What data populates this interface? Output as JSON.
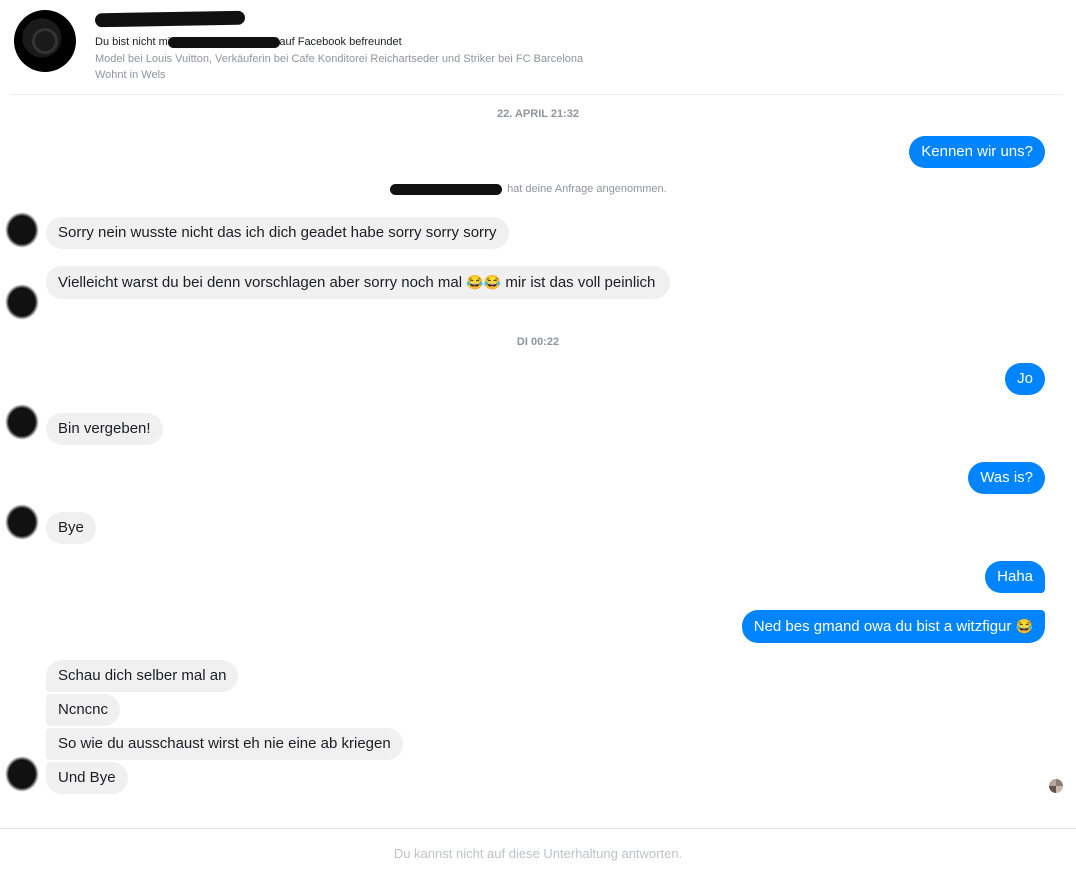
{
  "header": {
    "friend_prefix": "Du bist nicht mit",
    "friend_suffix": "auf Facebook befreundet",
    "work": "Model bei Louis Vuitton, Verkäuferin bei Cafe Konditorei Reichartseder und Striker bei FC Barcelona",
    "lives": "Wohnt in Wels"
  },
  "timestamps": {
    "first": "22. APRIL 21:32",
    "second": "DI 00:22"
  },
  "system_message": "hat deine Anfrage angenommen.",
  "messages": {
    "m1": "Kennen wir uns?",
    "m2": "Sorry nein wusste nicht das ich dich geadet habe sorry sorry sorry",
    "m3_text": "Vielleicht warst du bei denn vorschlagen aber sorry noch mal",
    "m3_emoji": "😂😂",
    "m3_tail": "mir ist das voll peinlich",
    "m4": "Jo",
    "m5": "Bin vergeben!",
    "m6": "Was is?",
    "m7": "Bye",
    "m8": "Haha",
    "m9_text": "Ned bes gmand owa du bist a witzfigur",
    "m9_emoji": "😂",
    "m10": "Schau dich selber mal an",
    "m11": "Ncncnc",
    "m12": "So wie du ausschaust wirst eh nie eine ab kriegen",
    "m13": "Und Bye"
  },
  "footer": {
    "notice": "Du kannst nicht auf diese Unterhaltung antworten."
  },
  "colors": {
    "outgoing_bubble": "#0084ff",
    "incoming_bubble": "#f1f0f0",
    "meta_text": "#90949c"
  }
}
